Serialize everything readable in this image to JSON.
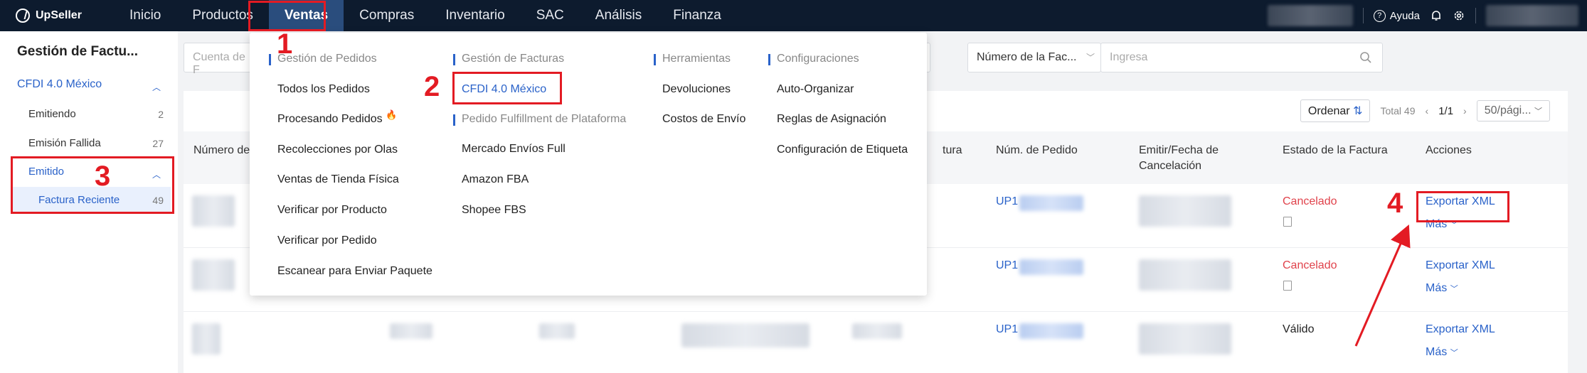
{
  "app": {
    "logo": "UpSeller"
  },
  "nav": [
    "Inicio",
    "Productos",
    "Ventas",
    "Compras",
    "Inventario",
    "SAC",
    "Análisis",
    "Finanza"
  ],
  "top_right": {
    "help": "Ayuda",
    "icons": [
      "help-circle-icon",
      "bell-icon",
      "gear-icon"
    ]
  },
  "sidebar": {
    "title": "Gestión de Factu...",
    "group": "CFDI 4.0 México",
    "items": [
      {
        "label": "Emitiendo",
        "count": "2"
      },
      {
        "label": "Emisión Fallida",
        "count": "27"
      }
    ],
    "sub_group": "Emitido",
    "sub_item": {
      "label": "Factura Reciente",
      "count": "49"
    }
  },
  "filters": {
    "invoice_account_placeholder": "Cuenta de F",
    "invoice_number_select": "Número de la Fac...",
    "search_placeholder": "Ingresa"
  },
  "toolbar": {
    "sort": "Ordenar",
    "total": "Total 49",
    "page": "1/1",
    "page_size": "50/pági..."
  },
  "table": {
    "headers": {
      "invoice_number": "Número de",
      "partial": "tura",
      "order_number": "Núm. de Pedido",
      "emit_cancel_1": "Emitir/Fecha de",
      "emit_cancel_2": "Cancelación",
      "state": "Estado de la Factura",
      "actions": "Acciones"
    },
    "rows": [
      {
        "order_prefix": "UP1",
        "state": "Cancelado",
        "export": "Exportar XML",
        "more": "Más"
      },
      {
        "order_prefix": "UP1",
        "state": "Cancelado",
        "export": "Exportar XML",
        "more": "Más"
      },
      {
        "order_prefix": "UP1",
        "state": "Válido",
        "export": "Exportar XML",
        "more": "Más"
      }
    ]
  },
  "dropdown": {
    "col1": {
      "head": "Gestión de Pedidos",
      "items": [
        "Todos los Pedidos",
        "Procesando Pedidos",
        "Recolecciones por Olas",
        "Ventas de Tienda Física",
        "Verificar por Producto",
        "Verificar por Pedido",
        "Escanear para Enviar Paquete"
      ]
    },
    "col2": {
      "head": "Gestión de Facturas",
      "selected": "CFDI 4.0 México",
      "head2": "Pedido Fulfillment de Plataforma",
      "items": [
        "Mercado Envíos Full",
        "Amazon FBA",
        "Shopee FBS"
      ]
    },
    "col3": {
      "head": "Herramientas",
      "items": [
        "Devoluciones",
        "Costos de Envío"
      ]
    },
    "col4": {
      "head": "Configuraciones",
      "items": [
        "Auto-Organizar",
        "Reglas de Asignación",
        "Configuración de Etiqueta"
      ]
    }
  },
  "annotations": [
    "1",
    "2",
    "3",
    "4"
  ],
  "colors": {
    "nav_bg": "#0d1b2e",
    "nav_active": "#2a4d7d",
    "link": "#2a62c9",
    "annotation": "#e31b23",
    "cancel": "#e0424b"
  }
}
